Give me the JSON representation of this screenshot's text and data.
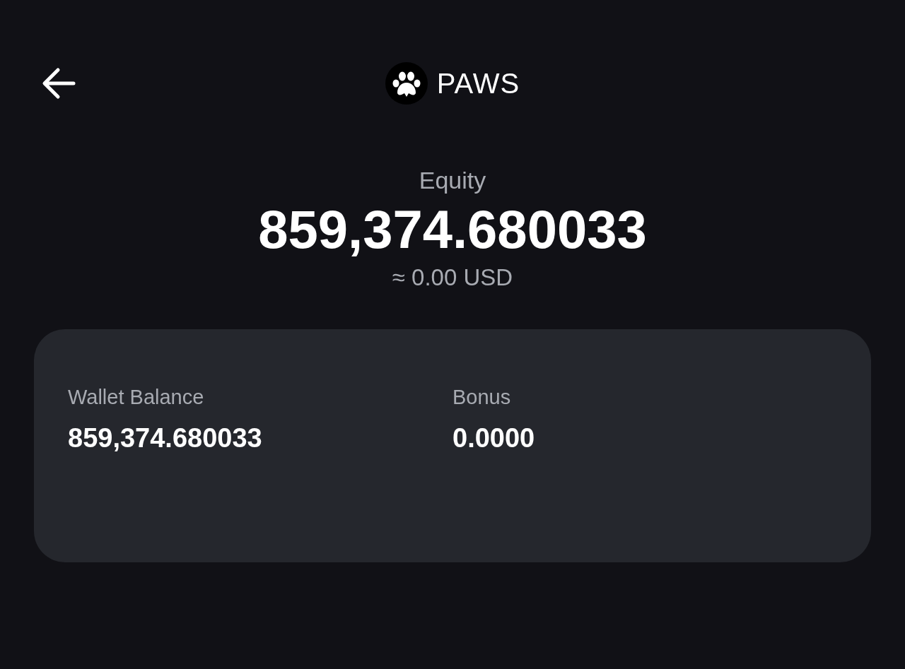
{
  "header": {
    "title": "PAWS"
  },
  "summary": {
    "label": "Equity",
    "value": "859,374.680033",
    "approx": "≈ 0.00 USD"
  },
  "card": {
    "items": [
      {
        "label": "Wallet Balance",
        "value": "859,374.680033"
      },
      {
        "label": "Bonus",
        "value": "0.0000"
      }
    ]
  }
}
